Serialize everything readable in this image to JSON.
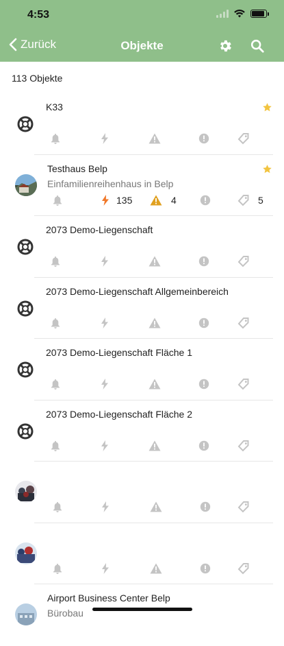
{
  "status": {
    "time": "4:53"
  },
  "nav": {
    "back_label": "Zurück",
    "title": "Objekte"
  },
  "summary": {
    "count_label": "113 Objekte"
  },
  "colors": {
    "header": "#8fbf8a",
    "icon_gray": "#c4c4c4",
    "accent_orange": "#f0782a",
    "warning": "#e0a020",
    "star": "#f2c440"
  },
  "objects": [
    {
      "title": "K33",
      "subtitle": "",
      "favorite": true,
      "leading": "lifebuoy-icon"
    },
    {
      "title": "Testhaus Belp",
      "subtitle": "Einfamilienreihenhaus in Belp",
      "favorite": true,
      "leading": "photo-avatar",
      "energy_count": "135",
      "warning_count": "4",
      "tags_count": "5"
    },
    {
      "title": "2073 Demo-Liegenschaft",
      "subtitle": "",
      "favorite": false,
      "leading": "lifebuoy-icon"
    },
    {
      "title": "2073 Demo-Liegenschaft Allgemeinbereich",
      "subtitle": "",
      "favorite": false,
      "leading": "lifebuoy-icon"
    },
    {
      "title": "2073 Demo-Liegenschaft Fläche 1",
      "subtitle": "",
      "favorite": false,
      "leading": "lifebuoy-icon"
    },
    {
      "title": "2073 Demo-Liegenschaft Fläche 2",
      "subtitle": "",
      "favorite": false,
      "leading": "lifebuoy-icon"
    },
    {
      "title": "",
      "subtitle": "",
      "favorite": false,
      "leading": "photo-avatar"
    },
    {
      "title": "",
      "subtitle": "",
      "favorite": false,
      "leading": "photo-avatar"
    },
    {
      "title": "Airport Business Center Belp",
      "subtitle": "Bürobau",
      "favorite": false,
      "leading": "photo-avatar"
    }
  ]
}
